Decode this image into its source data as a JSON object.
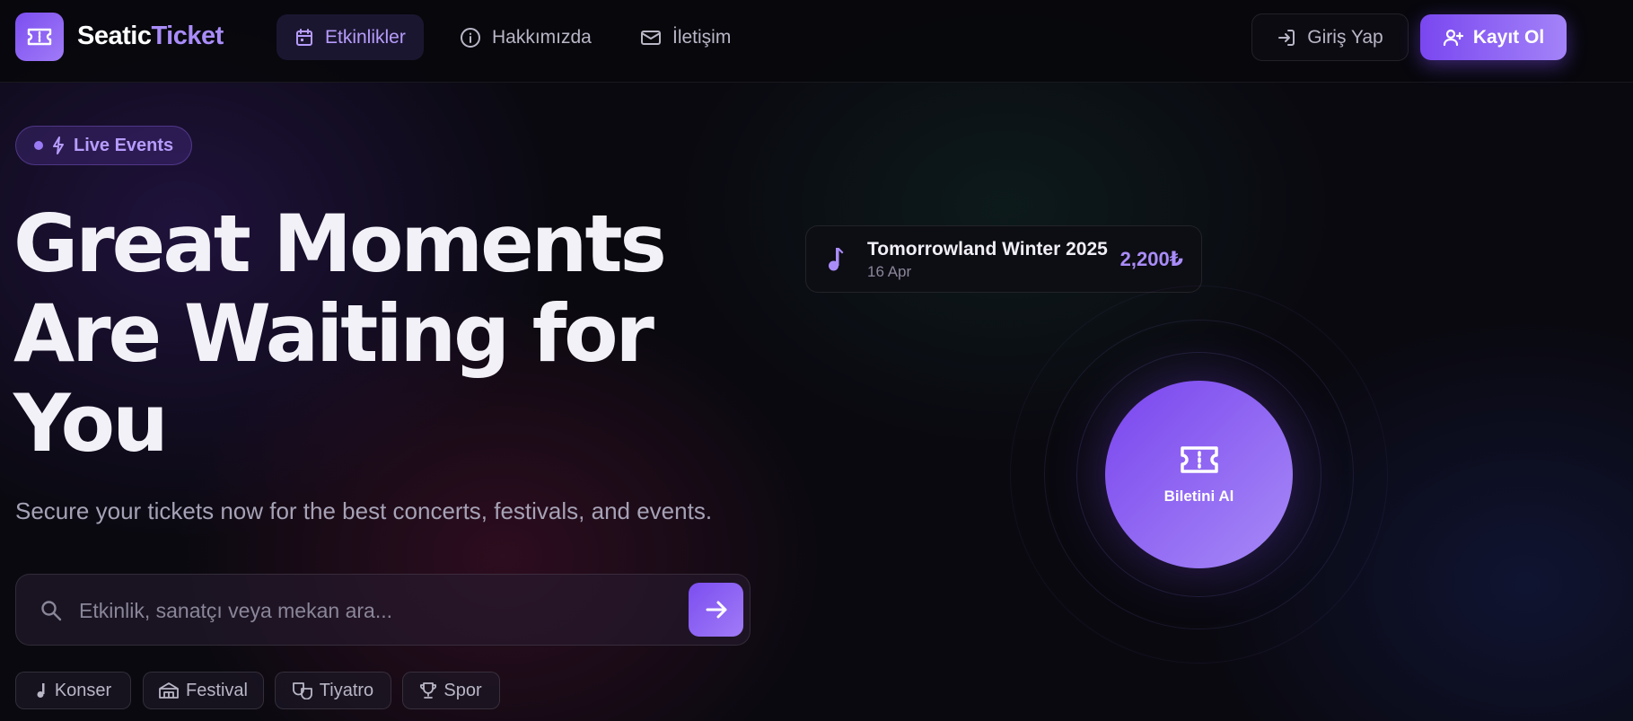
{
  "brand": {
    "part1": "Seatic",
    "part2": "Ticket",
    "accent": "#a98cf8"
  },
  "nav": {
    "items": [
      {
        "label": "Etkinlikler",
        "icon": "calendar-icon",
        "active": true
      },
      {
        "label": "Hakkımızda",
        "icon": "info-icon",
        "active": false
      },
      {
        "label": "İletişim",
        "icon": "mail-icon",
        "active": false
      }
    ],
    "login_label": "Giriş Yap",
    "signup_label": "Kayıt Ol"
  },
  "hero": {
    "badge": "Live Events",
    "headline": [
      "Great Moments",
      "Are Waiting for",
      "You"
    ],
    "subline": "Secure your tickets now for the best concerts, festivals, and events.",
    "search_placeholder": "Etkinlik, sanatçı veya mekan ara...",
    "search_value": ""
  },
  "categories": [
    {
      "label": "Konser",
      "icon": "music-note-icon"
    },
    {
      "label": "Festival",
      "icon": "tent-icon"
    },
    {
      "label": "Tiyatro",
      "icon": "theater-masks-icon"
    },
    {
      "label": "Spor",
      "icon": "trophy-icon"
    }
  ],
  "event_card": {
    "name": "Tomorrowland Winter 2025",
    "date": "16 Apr",
    "price": "2,200₺",
    "icon": "music-note-icon"
  },
  "cta": {
    "label": "Biletini Al",
    "icon": "ticket-icon"
  },
  "colors": {
    "primary": "#7c4ef0",
    "primary_light": "#a07bf7",
    "background": "#0a0910"
  }
}
